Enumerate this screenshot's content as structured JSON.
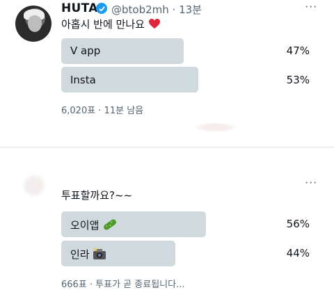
{
  "tweet1": {
    "name": "HUTA",
    "handle": "@btob2mh · 13분",
    "more": "···",
    "text": "아홉시 반에 만나요",
    "poll": {
      "options": [
        {
          "label": "V app",
          "percent": "47%",
          "fraction": 0.47
        },
        {
          "label": "Insta",
          "percent": "53%",
          "fraction": 0.53
        }
      ],
      "meta": "6,020표 · 11분 남음"
    }
  },
  "tweet2": {
    "more": "···",
    "text": "투표할까요?~~",
    "poll": {
      "options": [
        {
          "label": "오이앱",
          "percent": "56%",
          "fraction": 0.56
        },
        {
          "label": "인라",
          "percent": "44%",
          "fraction": 0.44
        }
      ],
      "meta": "666표 · 투표가 곧 종료됩니다..."
    }
  },
  "colors": {
    "verified": "#1d9bf0",
    "bar": "#cfd9de",
    "heart": "#e0243a"
  },
  "icons": [
    "verified-badge-icon",
    "heart-emoji-icon",
    "cucumber-emoji-icon",
    "camera-emoji-icon",
    "more-icon"
  ]
}
